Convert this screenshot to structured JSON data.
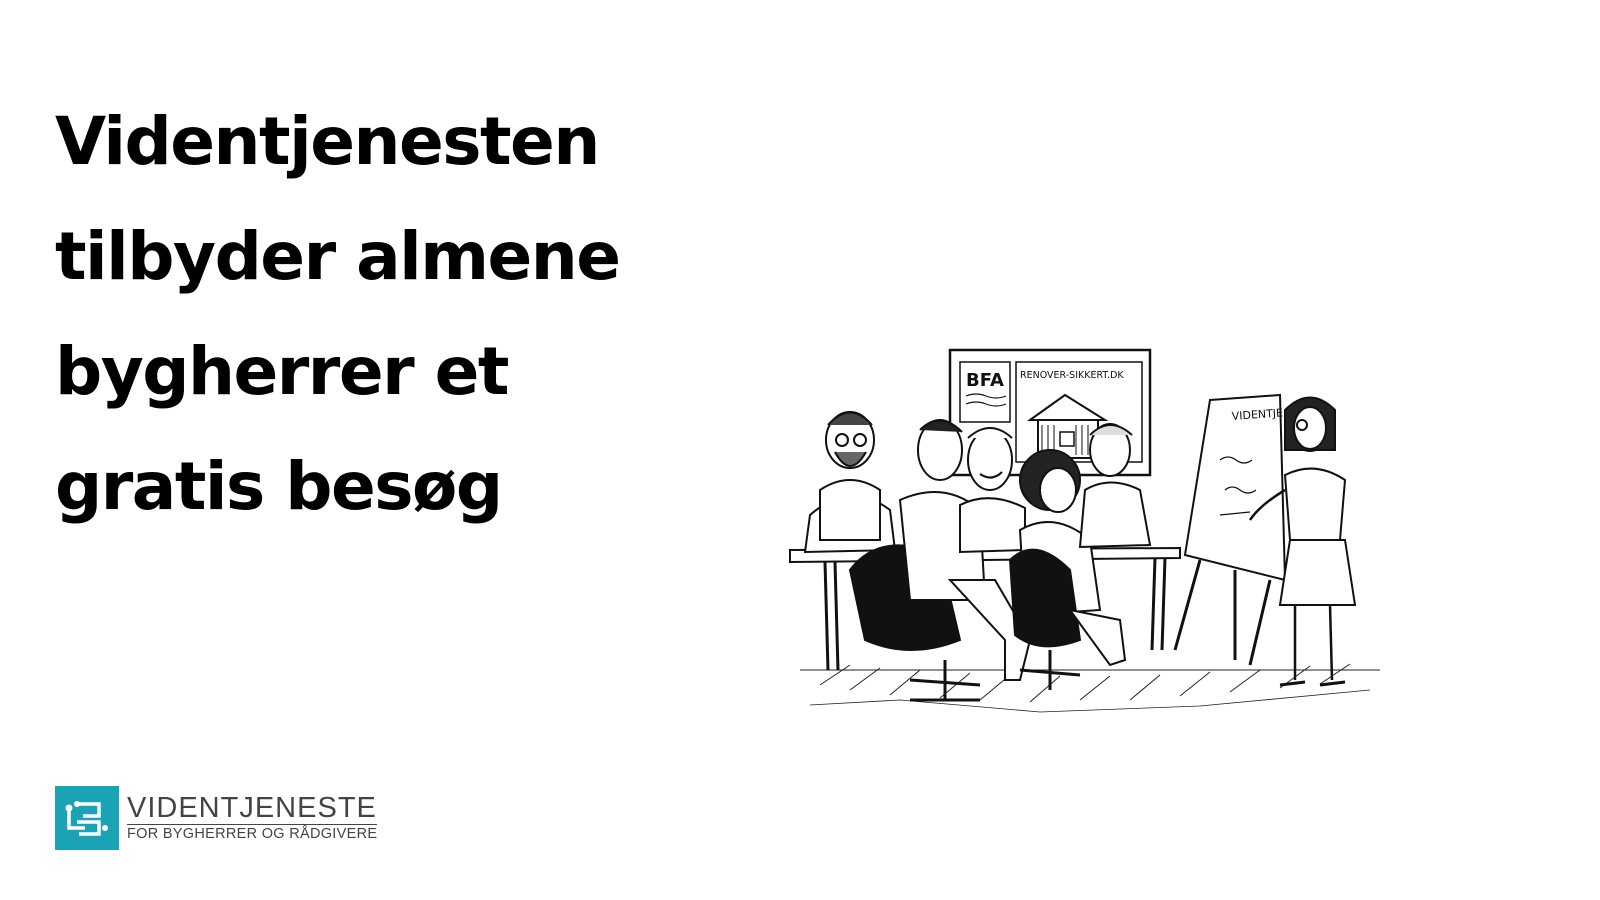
{
  "headline": {
    "lines": [
      "Videntjenesten",
      "tilbyder almene",
      "bygherrer et",
      "gratis besøg"
    ]
  },
  "illustration": {
    "poster_left": "BFA",
    "poster_right": "RENOVER-SIKKERT.DK",
    "flipchart_title": "VIDENTJE"
  },
  "logo": {
    "name": "VIDENTJENESTE",
    "tagline": "FOR BYGHERRER OG RÅDGIVERE",
    "accent_color": "#1aa3b5"
  },
  "colors": {
    "background": "#ffffff",
    "text": "#000000",
    "logo_text": "#444444"
  }
}
